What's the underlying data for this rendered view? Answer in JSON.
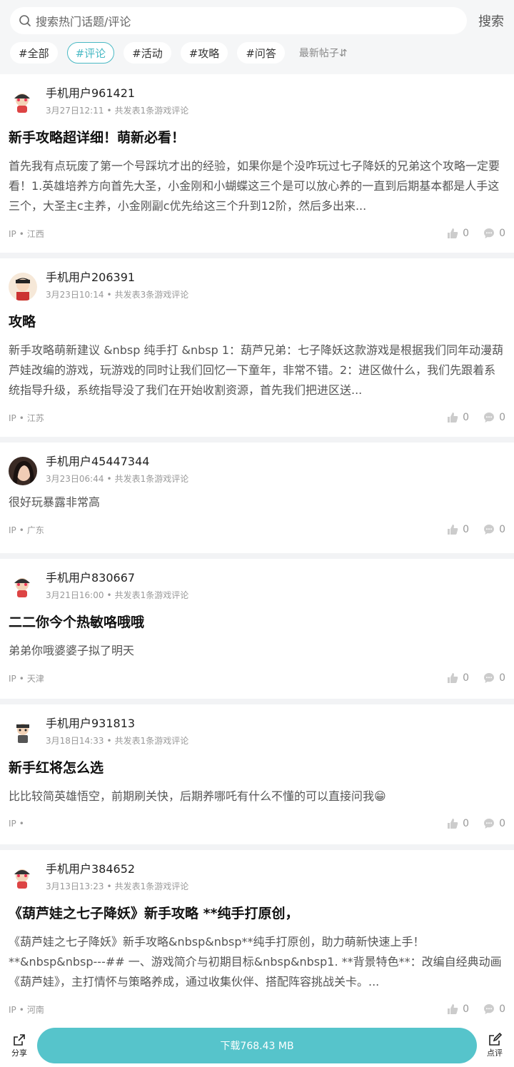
{
  "search": {
    "placeholder": "搜索热门话题/评论",
    "button": "搜索"
  },
  "filters": [
    {
      "label": "#全部"
    },
    {
      "label": "#评论"
    },
    {
      "label": "#活动"
    },
    {
      "label": "#攻略"
    },
    {
      "label": "#问答"
    }
  ],
  "sort": {
    "label": "最新帖子⇵"
  },
  "posts": [
    {
      "username": "手机用户961421",
      "date": "3月27日12:11",
      "summary": "共发表1条游戏评论",
      "title": "新手攻略超详细！萌新必看！",
      "body": "首先我有点玩废了第一个号踩坑才出的经验，如果你是个没咋玩过七子降妖的兄弟这个攻略一定要看！1.英雄培养方向首先大圣，小金刚和小蝴蝶这三个是可以放心养的一直到后期基本都是人手这三个，大圣主c主养，小金刚副c优先给这三个升到12阶，然后多出来...",
      "ip_label": "IP",
      "region": "江西",
      "likes": "0",
      "comments": "0"
    },
    {
      "username": "手机用户206391",
      "date": "3月23日10:14",
      "summary": "共发表3条游戏评论",
      "title": "攻略",
      "body": "新手攻略萌新建议 &nbsp 纯手打 &nbsp 1：葫芦兄弟：七子降妖这款游戏是根据我们同年动漫葫芦娃改编的游戏，玩游戏的同时让我们回忆一下童年，非常不错。2：进区做什么，我们先跟着系统指导升级，系统指导没了我们在开始收割资源，首先我们把进区送...",
      "ip_label": "IP",
      "region": "江苏",
      "likes": "0",
      "comments": "0"
    },
    {
      "username": "手机用户45447344",
      "date": "3月23日06:44",
      "summary": "共发表1条游戏评论",
      "title": "",
      "body": "很好玩暴露非常高",
      "ip_label": "IP",
      "region": "广东",
      "likes": "0",
      "comments": "0"
    },
    {
      "username": "手机用户830667",
      "date": "3月21日16:00",
      "summary": "共发表1条游戏评论",
      "title": "二二你今个热敏咯哦哦",
      "body": "弟弟你哦婆婆子拟了明天",
      "ip_label": "IP",
      "region": "天津",
      "likes": "0",
      "comments": "0"
    },
    {
      "username": "手机用户931813",
      "date": "3月18日14:33",
      "summary": "共发表1条游戏评论",
      "title": "新手红将怎么选",
      "body": "比比较简英雄悟空，前期刷关快，后期养哪吒有什么不懂的可以直接问我😁",
      "ip_label": "IP",
      "region": "",
      "likes": "0",
      "comments": "0"
    },
    {
      "username": "手机用户384652",
      "date": "3月13日13:23",
      "summary": "共发表1条游戏评论",
      "title": "《葫芦娃之七子降妖》新手攻略 **纯手打原创，",
      "body": "《葫芦娃之七子降妖》新手攻略&nbsp&nbsp**纯手打原创，助力萌新快速上手！**&nbsp&nbsp---## 一、游戏简介与初期目标&nbsp&nbsp1. **背景特色**：改编自经典动画《葫芦娃》，主打情怀与策略养成，通过收集伙伴、搭配阵容挑战关卡。...",
      "ip_label": "IP",
      "region": "河南",
      "likes": "0",
      "comments": "0"
    }
  ],
  "bottom": {
    "share": "分享",
    "download": "下载768.43 MB",
    "review": "点评"
  },
  "colors": {
    "accent": "#49b9c4",
    "download": "#56c4cb"
  }
}
